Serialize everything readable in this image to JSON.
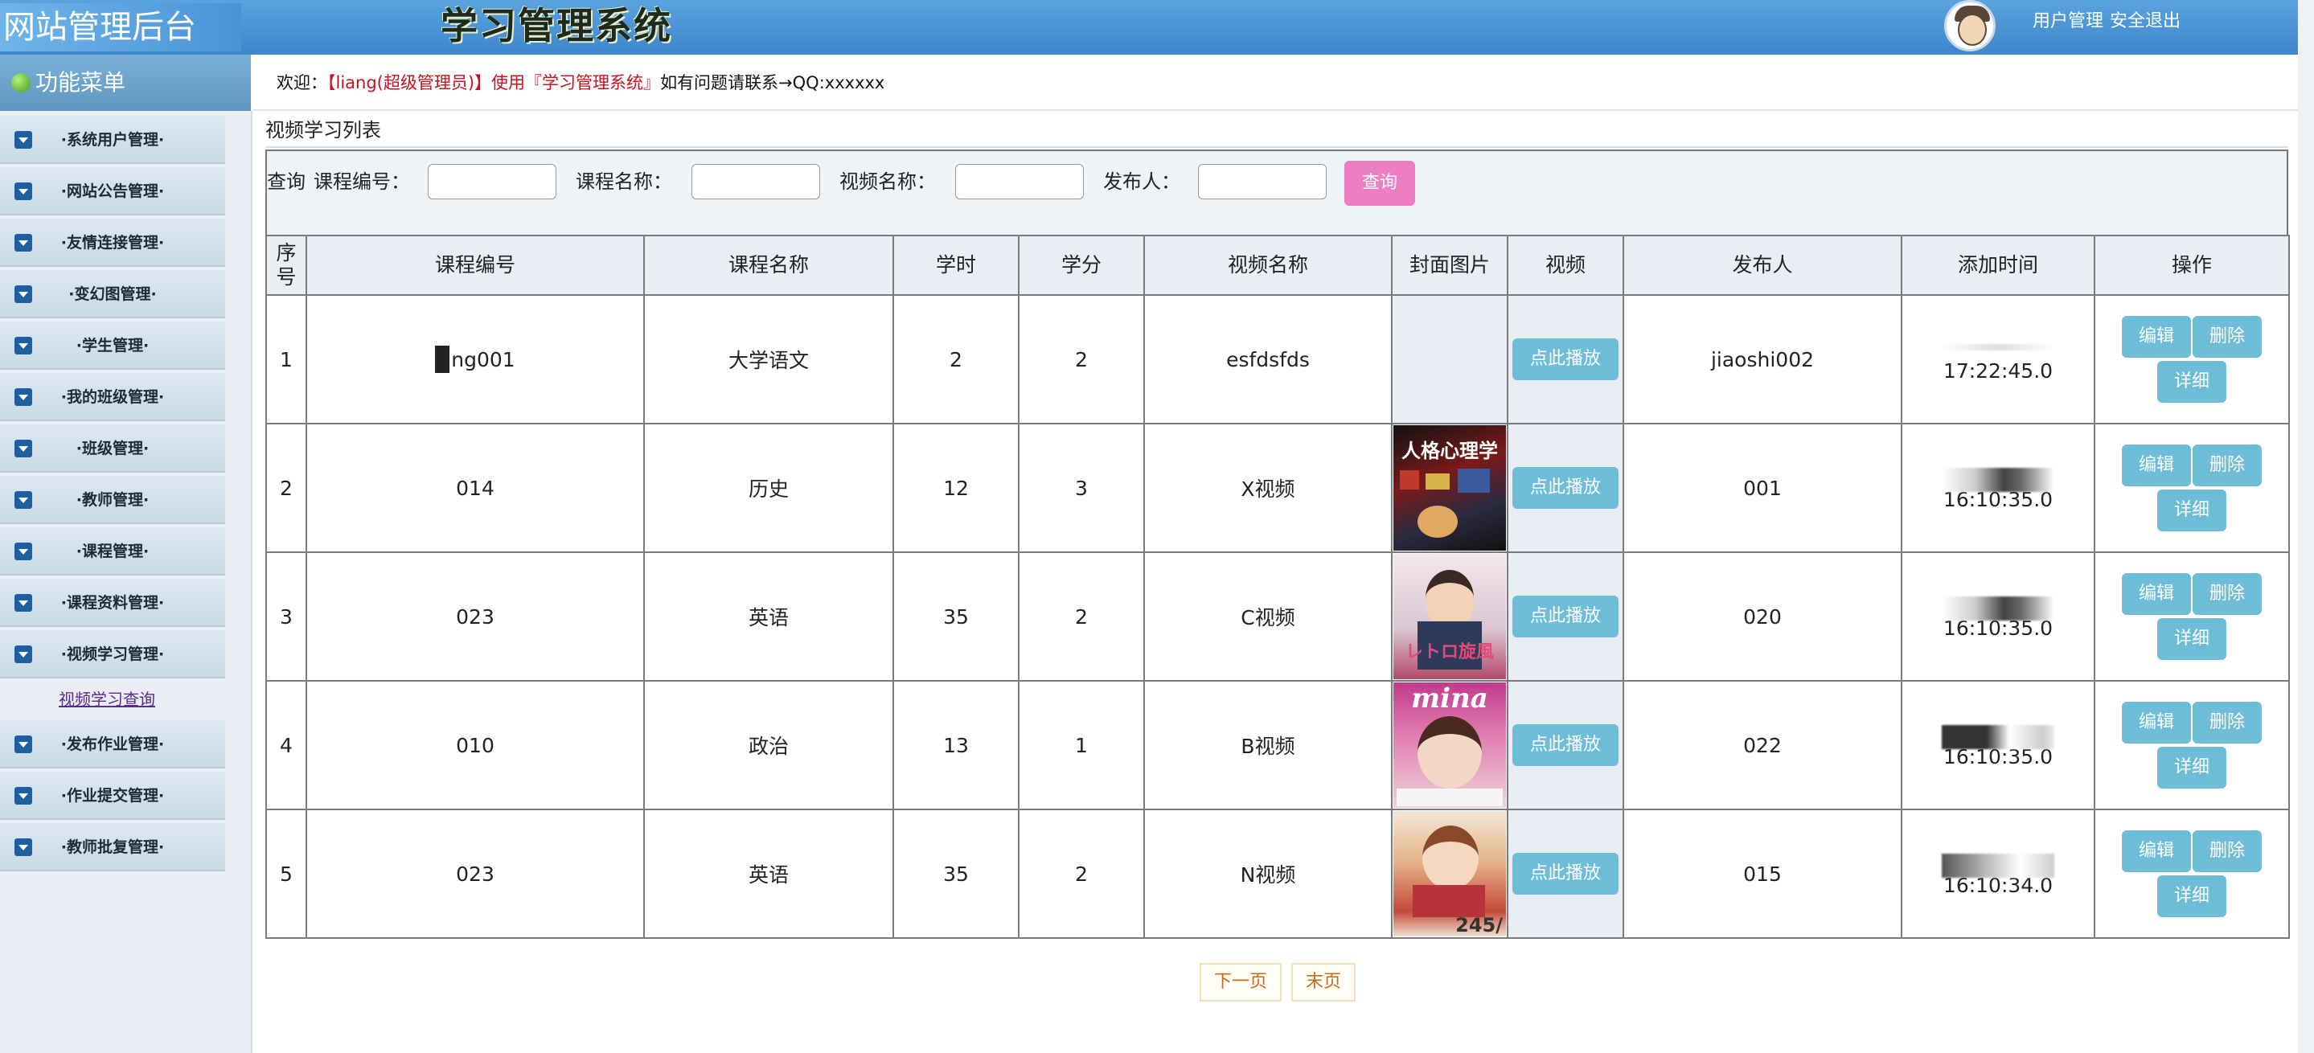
{
  "header": {
    "site_title": "网站管理后台",
    "system_title": "学习管理系统",
    "user_link": "用户管理",
    "logout_link": "安全退出"
  },
  "menu": {
    "title": "功能菜单",
    "items": [
      "·系统用户管理·",
      "·网站公告管理·",
      "·友情连接管理·",
      "·变幻图管理·",
      "·学生管理·",
      "·我的班级管理·",
      "·班级管理·",
      "·教师管理·",
      "·课程管理·",
      "·课程资料管理·",
      "·视频学习管理·",
      "·发布作业管理·",
      "·作业提交管理·",
      "·教师批复管理·"
    ],
    "sub_link": "视频学习查询"
  },
  "welcome": {
    "prefix": "欢迎：",
    "user": "【liang(超级管理员)】使用『学习管理系统』",
    "suffix": "如有问题请联系→QQ:xxxxxx"
  },
  "page": {
    "list_title": "视频学习列表"
  },
  "query": {
    "label_query": "查询",
    "label_course_no": "课程编号：",
    "label_course_name": "课程名称：",
    "label_video_name": "视频名称：",
    "label_publisher": "发布人：",
    "course_no_value": "",
    "course_name_value": "",
    "video_name_value": "",
    "publisher_value": "",
    "button": "查询"
  },
  "table": {
    "headers": [
      "序号",
      "课程编号",
      "课程名称",
      "学时",
      "学分",
      "视频名称",
      "封面图片",
      "视频",
      "发布人",
      "添加时间",
      "操作"
    ],
    "play_label": "点此播放",
    "edit_label": "编辑",
    "delete_label": "删除",
    "detail_label": "详细",
    "rows": [
      {
        "no": "1",
        "course_no": "ng001",
        "course_name": "大学语文",
        "hours": "2",
        "credit": "2",
        "video_name": "esfdsfds",
        "publisher": "jiaoshi002",
        "time": "17:22:45.0"
      },
      {
        "no": "2",
        "course_no": "014",
        "course_name": "历史",
        "hours": "12",
        "credit": "3",
        "video_name": "X视频",
        "publisher": "001",
        "time": "16:10:35.0",
        "cover_text": "人格心理学"
      },
      {
        "no": "3",
        "course_no": "023",
        "course_name": "英语",
        "hours": "35",
        "credit": "2",
        "video_name": "C视频",
        "publisher": "020",
        "time": "16:10:35.0",
        "cover_text": "レトロ旋風"
      },
      {
        "no": "4",
        "course_no": "010",
        "course_name": "政治",
        "hours": "13",
        "credit": "1",
        "video_name": "B视频",
        "publisher": "022",
        "time": "16:10:35.0",
        "cover_text": "mina"
      },
      {
        "no": "5",
        "course_no": "023",
        "course_name": "英语",
        "hours": "35",
        "credit": "2",
        "video_name": "N视频",
        "publisher": "015",
        "time": "16:10:34.0",
        "cover_text": "245/"
      }
    ]
  },
  "pager": {
    "next": "下一页",
    "last": "末页"
  }
}
